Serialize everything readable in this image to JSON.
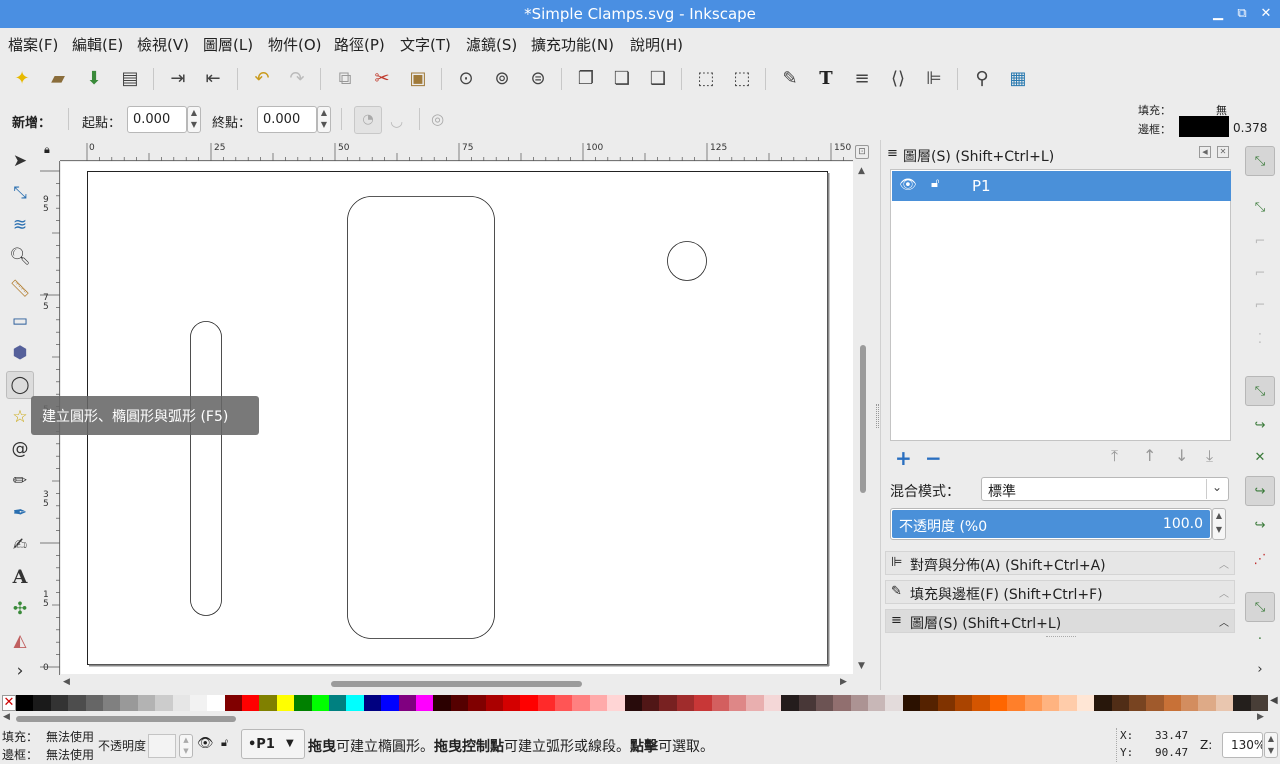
{
  "window": {
    "title": "*Simple Clamps.svg - Inkscape",
    "buttons": [
      "minimize-icon",
      "maximize-icon",
      "close-icon"
    ]
  },
  "menu": [
    "檔案(F)",
    "編輯(E)",
    "檢視(V)",
    "圖層(L)",
    "物件(O)",
    "路徑(P)",
    "文字(T)",
    "濾鏡(S)",
    "擴充功能(N)",
    "說明(H)"
  ],
  "tool_controls": {
    "new_label": "新增：",
    "start_label": "起點：",
    "start_value": "0.000",
    "end_label": "終點：",
    "end_value": "0.000"
  },
  "style_indicator": {
    "fill_label": "填充：",
    "fill_value": "無",
    "stroke_label": "邊框：",
    "stroke_width": "0.378",
    "stroke_color": "#000000"
  },
  "rulers": {
    "top_ticks": [
      "0",
      "25",
      "50",
      "75",
      "100",
      "125",
      "150"
    ],
    "left_ticks": [
      "9\n5",
      "7\n5",
      "5",
      "3\n5",
      "1\n5",
      "0"
    ]
  },
  "tooltip": "建立圓形、橢圓形與弧形 (F5)",
  "layers_panel": {
    "title": "圖層(S) (Shift+Ctrl+L)",
    "layer_name": "P1",
    "blend_label": "混合模式：",
    "blend_value": "標準",
    "opacity_label": "不透明度 (%0",
    "opacity_value": "100.0",
    "opacity_fraction": 1.0
  },
  "collapsed_panels": [
    "對齊與分佈(A) (Shift+Ctrl+A)",
    "填充與邊框(F) (Shift+Ctrl+F)",
    "圖層(S) (Shift+Ctrl+L)"
  ],
  "status": {
    "fill_label": "填充：",
    "fill_value": "無法使用",
    "stroke_label": "邊框：",
    "stroke_value": "無法使用",
    "opacity_label": "不透明度：",
    "layer_value": "•P1",
    "message_b1": "拖曳",
    "message_t1": "可建立橢圓形。",
    "message_b2": "拖曳控制點",
    "message_t2": "可建立弧形或線段。",
    "message_b3": "點擊",
    "message_t3": "可選取。",
    "x_label": "X:",
    "x_value": "33.47",
    "y_label": "Y:",
    "y_value": "90.47",
    "zoom_label": "Z:",
    "zoom_value": "130%"
  },
  "palette_colors": [
    "#000000",
    "#1a1a1a",
    "#333333",
    "#4d4d4d",
    "#666666",
    "#808080",
    "#999999",
    "#b3b3b3",
    "#cccccc",
    "#e6e6e6",
    "#f2f2f2",
    "#ffffff",
    "#800000",
    "#ff0000",
    "#808000",
    "#ffff00",
    "#008000",
    "#00ff00",
    "#008080",
    "#00ffff",
    "#000080",
    "#0000ff",
    "#800080",
    "#ff00ff",
    "#2b0000",
    "#550000",
    "#800000",
    "#aa0000",
    "#d40000",
    "#ff0000",
    "#ff2a2a",
    "#ff5555",
    "#ff8080",
    "#ffaaaa",
    "#ffd5d5",
    "#280b0b",
    "#501616",
    "#782121",
    "#a02c2c",
    "#c83737",
    "#d35f5f",
    "#de8787",
    "#e9afaf",
    "#f4d7d7",
    "#241c1c",
    "#483737",
    "#6c5353",
    "#916f6f",
    "#ac9393",
    "#c8b7b7",
    "#e3dbdb",
    "#2b1100",
    "#552200",
    "#803300",
    "#aa4400",
    "#d45500",
    "#ff6600",
    "#ff7f2a",
    "#ff9955",
    "#ffb380",
    "#ffccaa",
    "#ffe6d5",
    "#28170b",
    "#502d16",
    "#784421",
    "#a05a2c",
    "#c87137",
    "#d38d5f",
    "#deaa87",
    "#e9c6af",
    "#241f1c",
    "#483e37"
  ]
}
